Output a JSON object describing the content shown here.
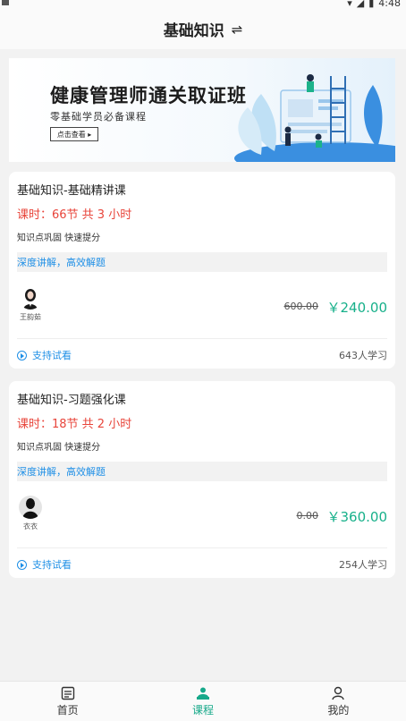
{
  "header": {
    "title": "基础知识",
    "swap_icon": "⇌"
  },
  "banner": {
    "title": "健康管理师通关取证班",
    "subtitle": "零基础学员必备课程",
    "button": "点击查看 ▸"
  },
  "courses": [
    {
      "title": "基础知识-基础精讲课",
      "hours": "课时：66节 共 3 小时",
      "tags": "知识点巩固 快速提分",
      "feature": "深度讲解，高效解题",
      "teacher": "王韵茹",
      "price_original": "600.00",
      "price_current": "￥240.00",
      "trial": "支持试看",
      "learners": "643人学习"
    },
    {
      "title": "基础知识-习题强化课",
      "hours": "课时：18节 共 2 小时",
      "tags": "知识点巩固 快速提分",
      "feature": "深度讲解，高效解题",
      "teacher": "衣衣",
      "price_original": "0.00",
      "price_current": "￥360.00",
      "trial": "支持试看",
      "learners": "254人学习"
    }
  ],
  "tabbar": {
    "items": [
      {
        "label": "首页",
        "icon": "home-icon"
      },
      {
        "label": "课程",
        "icon": "course-icon",
        "active": true
      },
      {
        "label": "我的",
        "icon": "profile-icon"
      }
    ]
  },
  "colors": {
    "accent": "#17a98a",
    "price": "#17b08a",
    "hours": "#e8443a",
    "link": "#1e8fe6"
  },
  "statusbar": {
    "time": "4:48"
  }
}
